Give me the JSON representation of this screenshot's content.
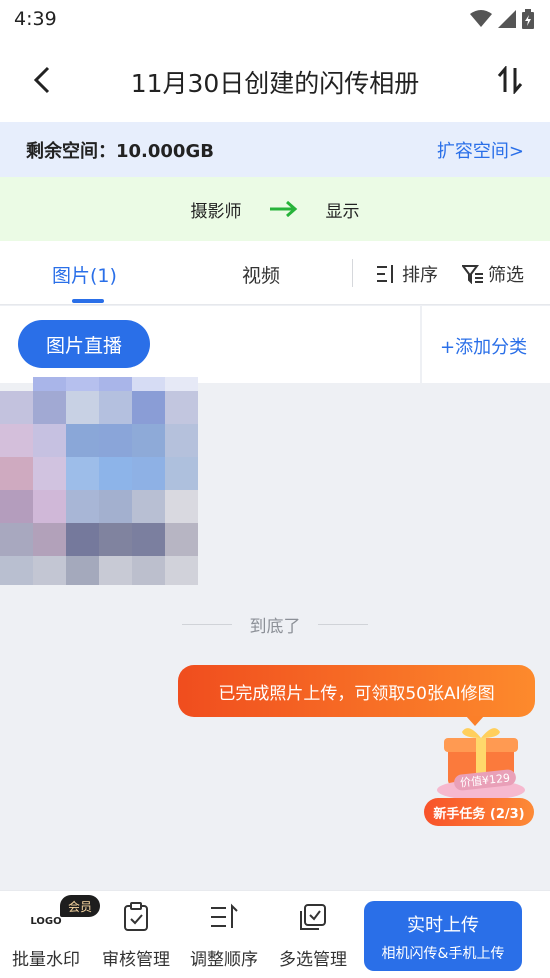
{
  "status_bar": {
    "time": "4:39"
  },
  "header": {
    "title": "11月30日创建的闪传相册"
  },
  "storage": {
    "remaining": "剩余空间：10.000GB",
    "expand_link": "扩容空间>"
  },
  "flow": {
    "from": "摄影师",
    "to": "显示"
  },
  "tabs": {
    "photos": "图片(1)",
    "videos": "视频",
    "sort": "排序",
    "filter": "筛选"
  },
  "category": {
    "live": "图片直播",
    "add": "+添加分类"
  },
  "list": {
    "end_text": "到底了"
  },
  "promo": {
    "message": "已完成照片上传，可领取50张AI修图",
    "price": "价值¥129",
    "task": "新手任务 (2/3)"
  },
  "bottom_bar": {
    "vip_badge": "会员",
    "logo_mark": "LOGO",
    "watermark": "批量水印",
    "review": "审核管理",
    "reorder": "调整顺序",
    "multi_select": "多选管理",
    "upload_main": "实时上传",
    "upload_sub": "相机闪传&手机上传"
  },
  "colors": {
    "accent": "#2a6fe8",
    "promo": "#f04d1e",
    "storage_bg": "#e7eefc",
    "flow_bg": "#ebfbe5",
    "flow_arrow": "#27b33a"
  },
  "icons": [
    "wifi-icon",
    "signal-icon",
    "battery-icon",
    "back-arrow-icon",
    "sort-swap-icon",
    "green-arrow-icon",
    "sort-icon",
    "filter-icon",
    "gift-icon",
    "review-icon",
    "reorder-icon",
    "multi-select-icon"
  ]
}
